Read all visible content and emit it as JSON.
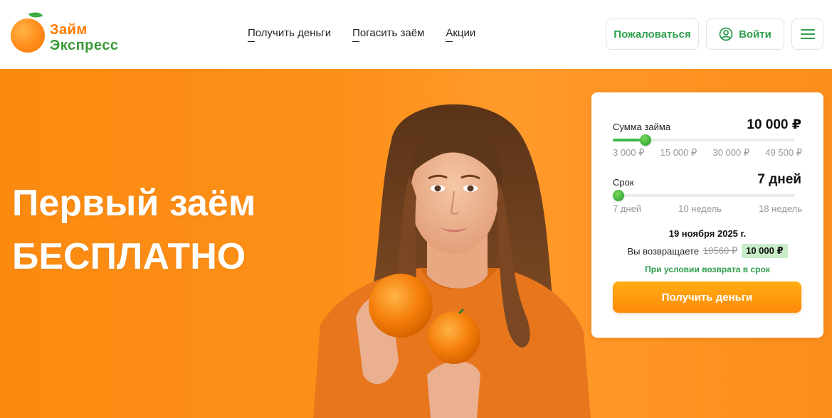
{
  "brand": {
    "line1": "Займ",
    "line2": "Экспресс",
    "colors": {
      "orange": "#ff7a00",
      "green": "#3a9a3a",
      "accent_green": "#2e9e4d"
    }
  },
  "nav": {
    "items": [
      {
        "label": "Получить деньги"
      },
      {
        "label": "Погасить заём"
      },
      {
        "label": "Акции"
      }
    ]
  },
  "header_actions": {
    "complain_label": "Пожаловаться",
    "login_label": "Войти",
    "login_icon": "user-circle-icon",
    "menu_icon": "hamburger-icon"
  },
  "hero": {
    "title_line1": "Первый заём",
    "title_line2": "БЕСПЛАТНО",
    "background": "#fd8f18"
  },
  "calculator": {
    "amount": {
      "label": "Сумма займа",
      "value": "10 000 ₽",
      "slider_fraction": 0.15,
      "ticks": [
        "3 000 ₽",
        "15 000 ₽",
        "30 000 ₽",
        "49 500 ₽"
      ]
    },
    "term": {
      "label": "Срок",
      "value": "7 дней",
      "slider_fraction": 0.0,
      "ticks": [
        "7 дней",
        "10 недель",
        "18 недель"
      ]
    },
    "date": "19 ноября 2025 г.",
    "return_label": "Вы возвращаете",
    "old_price": "10560 ₽",
    "new_price": "10 000 ₽",
    "condition": "При условии возврата в срок",
    "submit_label": "Получить деньги"
  }
}
